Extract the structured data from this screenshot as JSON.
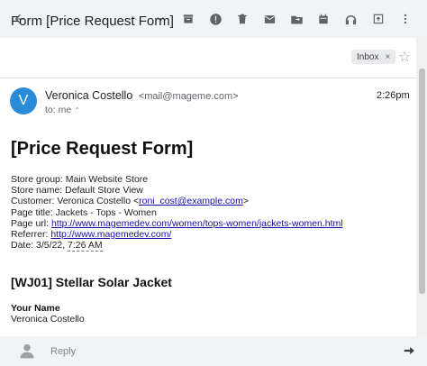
{
  "colors": {
    "toolbar_bg": "#f1f3f4",
    "toolbar_icon": "#5f6368",
    "toolbar_icon_disabled": "#c6c9cc",
    "avatar": "#2a8bd8",
    "link": "#1a0dab"
  },
  "toolbar": {
    "icons": [
      "back-arrow-icon",
      "chevron-up-icon",
      "chevron-down-icon",
      "archive-icon",
      "report-spam-icon",
      "delete-icon",
      "mark-unread-icon",
      "move-to-icon",
      "snooze-icon",
      "audio-icon",
      "open-external-icon",
      "more-icon"
    ]
  },
  "header": {
    "subject": "Form [Price Request Form]",
    "label_chip": "Inbox",
    "label_chip_close": "×",
    "star": "☆"
  },
  "message": {
    "avatar_letter": "V",
    "sender_name": "Veronica Costello",
    "sender_email": "<mail@mageme.com>",
    "to_line": "to: me",
    "to_chevron": "⌃",
    "time": "2:26pm"
  },
  "body": {
    "title": "[Price Request Form]",
    "details": [
      {
        "text": "Store group: Main Website Store"
      },
      {
        "text": "Store name: Default Store View"
      },
      {
        "prefix": "Customer: Veronica Costello <",
        "link": "roni_cost@example.com",
        "suffix": ">"
      },
      {
        "text": "Page title: Jackets - Tops - Women"
      },
      {
        "prefix": "Page url: ",
        "link": "http://www.magemedev.com/women/tops-women/jackets-women.html"
      },
      {
        "prefix": "Referrer: ",
        "link": "http://www.magemedev.com/"
      },
      {
        "prefix": "Date: ",
        "date": "3/5/22, ",
        "dotted": "7:26 AM"
      }
    ],
    "product": "[WJ01] Stellar Solar Jacket",
    "field_label": "Your Name",
    "field_value": "Veronica Costello"
  },
  "reply": {
    "label": "Reply"
  }
}
